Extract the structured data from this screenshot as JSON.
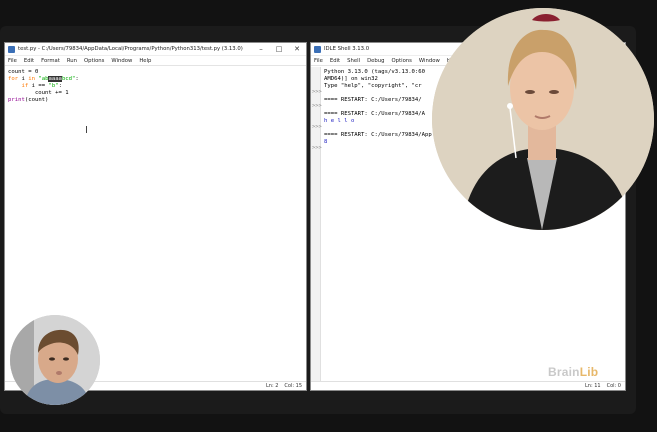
{
  "editor": {
    "title": "test.py - C:/Users/79834/AppData/Local/Programs/Python/Python313/test.py (3.13.0)",
    "menu": [
      "File",
      "Edit",
      "Format",
      "Run",
      "Options",
      "Window",
      "Help"
    ],
    "code": {
      "line1": "count = 0",
      "line2_kw": "for",
      "line2_a": " i ",
      "line2_in": "in",
      "line2_sp": " ",
      "line2_str_a": "\"ab",
      "line2_sel": "aaaa",
      "line2_str_b": "bcd\"",
      "line2_colon": ":",
      "line3_indent": "    ",
      "line3_kw": "if",
      "line3_a": " i == ",
      "line3_str": "\"b\"",
      "line3_colon": ":",
      "line4": "        count += 1",
      "line5_bi": "print",
      "line5_rest": "(count)"
    },
    "status": {
      "line": "Ln: 2",
      "col": "Col: 15"
    }
  },
  "shell": {
    "title": "IDLE Shell 3.13.0",
    "menu": [
      "File",
      "Edit",
      "Shell",
      "Debug",
      "Options",
      "Window",
      "H"
    ],
    "lines": {
      "l1": "Python 3.13.0 (tags/v3.13.0:60",
      "l2": "AMD64)] on win32",
      "l3": "Type \"help\", \"copyright\", \"cr",
      "l4": "==== RESTART: C:/Users/79834/",
      "l5": "==== RESTART: C:/Users/79834/A",
      "l6": "h e l l o",
      "l7": "==== RESTART: C:/Users/79834/App",
      "l8": "8"
    },
    "prompts": [
      ">>>",
      ">>>",
      ">>>",
      ">>>"
    ],
    "status": {
      "line": "Ln: 11",
      "col": "Col: 0"
    }
  },
  "brand": {
    "part1": "Brain",
    "part2": "Lib"
  },
  "colors": {
    "keyword": "#ff7700",
    "string": "#00aa00",
    "builtin": "#900090",
    "output": "#2020c0",
    "brand_accent": "#e7b86a"
  }
}
